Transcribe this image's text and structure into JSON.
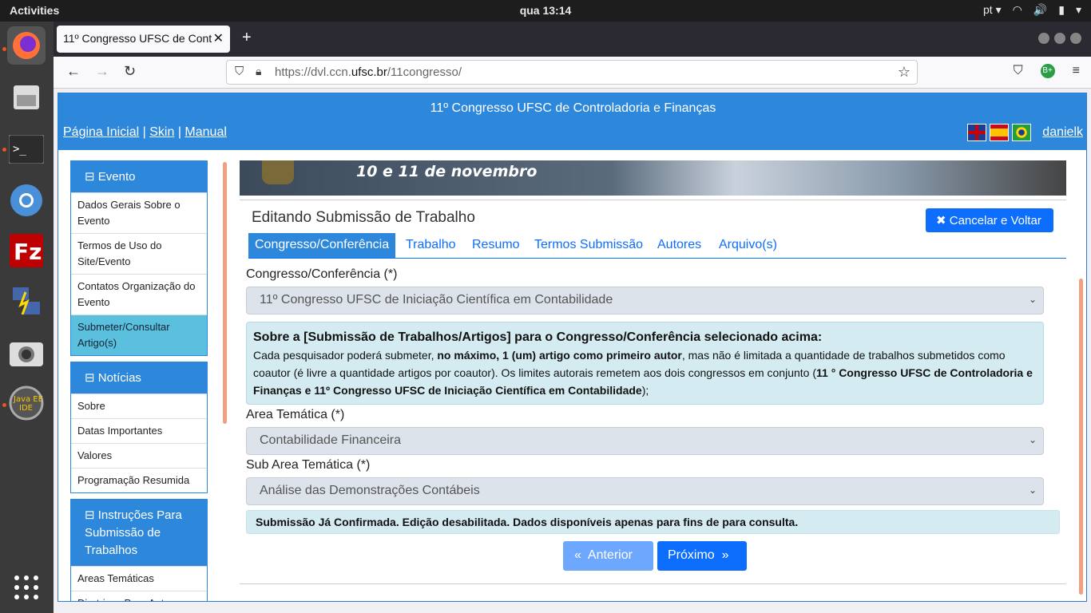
{
  "topbar": {
    "activities": "Activities",
    "clock": "qua 13:14",
    "lang": "pt ▾"
  },
  "browser": {
    "tab_title": "11º Congresso UFSC de Cont",
    "url_prefix": "https://dvl.ccn.",
    "url_domain": "ufsc.br",
    "url_path": "/11congresso/"
  },
  "header": {
    "title": "11º Congresso UFSC de Controladoria e Finanças",
    "link_home": "Página Inicial",
    "link_skin": "Skin",
    "link_manual": "Manual",
    "user": "danielk"
  },
  "sidebar": {
    "panels": [
      {
        "title": "Evento",
        "items": [
          "Dados Gerais Sobre o Evento",
          "Termos de Uso do Site/Evento",
          "Contatos Organização do Evento",
          "Submeter/Consultar Artigo(s)"
        ]
      },
      {
        "title": "Notícias",
        "items": [
          "Sobre",
          "Datas Importantes",
          "Valores",
          "Programação Resumida"
        ]
      },
      {
        "title": "Instruções Para Submissão de Trabalhos",
        "items": [
          "Areas Temáticas",
          "Diretrizes Para Autores"
        ]
      }
    ]
  },
  "banner": {
    "text": "10 e 11 de novembro"
  },
  "main": {
    "heading": "Editando Submissão de Trabalho",
    "cancel": "Cancelar e Voltar",
    "tabs": [
      "Congresso/Conferência",
      "Trabalho",
      "Resumo",
      "Termos Submissão",
      "Autores",
      "Arquivo(s)"
    ],
    "congress_label": "Congresso/Conferência (*)",
    "congress_value": "11º Congresso UFSC de Iniciação Científica em Contabilidade",
    "info_title": "Sobre a [Submissão de Trabalhos/Artigos] para o Congresso/Conferência selecionado acima:",
    "info_p1": "Cada pesquisador poderá submeter, ",
    "info_b1": "no máximo, 1 (um) artigo como primeiro autor",
    "info_p2": ", mas não é limitada a quantidade de trabalhos submetidos como coautor (é livre a quantidade artigos por coautor). Os limites autorais remetem aos dois congressos em conjunto (",
    "info_b2": "11 ° Congresso UFSC de Controladoria e Finanças e 11º Congresso UFSC de Iniciação Científica em Contabilidade",
    "info_p3": ");",
    "area_label": "Area Temática (*)",
    "area_value": "Contabilidade Financeira",
    "subarea_label": "Sub Area Temática (*)",
    "subarea_value": "Análise das Demonstrações Contábeis",
    "note": "Submissão Já Confirmada. Edição desabilitada. Dados disponíveis apenas para fins de para consulta.",
    "prev": "Anterior",
    "next": "Próximo"
  }
}
